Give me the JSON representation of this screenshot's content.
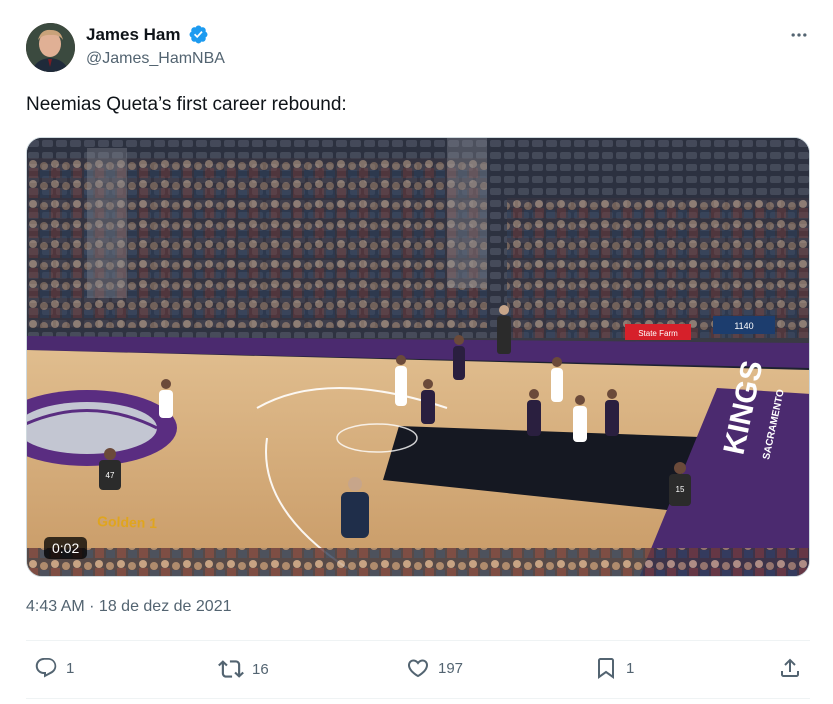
{
  "author": {
    "display_name": "James Ham",
    "handle": "@James_HamNBA",
    "verified": true
  },
  "tweet": {
    "text": "Neemias Queta’s first career rebound:",
    "timestamp": "4:43 AM · 18 de dez de 2021"
  },
  "media": {
    "type": "video",
    "duration": "0:02",
    "court_texts": [
      "KINGS",
      "SACRAMENTO",
      "Golden 1",
      "State Farm"
    ],
    "jersey_numbers": [
      "47",
      "15"
    ],
    "board_text": "1140"
  },
  "actions": {
    "replies": "1",
    "reposts": "16",
    "likes": "197",
    "bookmarks": "1"
  },
  "colors": {
    "verified": "#1d9bf0",
    "muted_text": "#536471",
    "kings_purple": "#5a2d81"
  },
  "icons": [
    "verified-badge-icon",
    "more-options-icon",
    "reply-icon",
    "repost-icon",
    "like-icon",
    "bookmark-icon",
    "share-icon"
  ]
}
